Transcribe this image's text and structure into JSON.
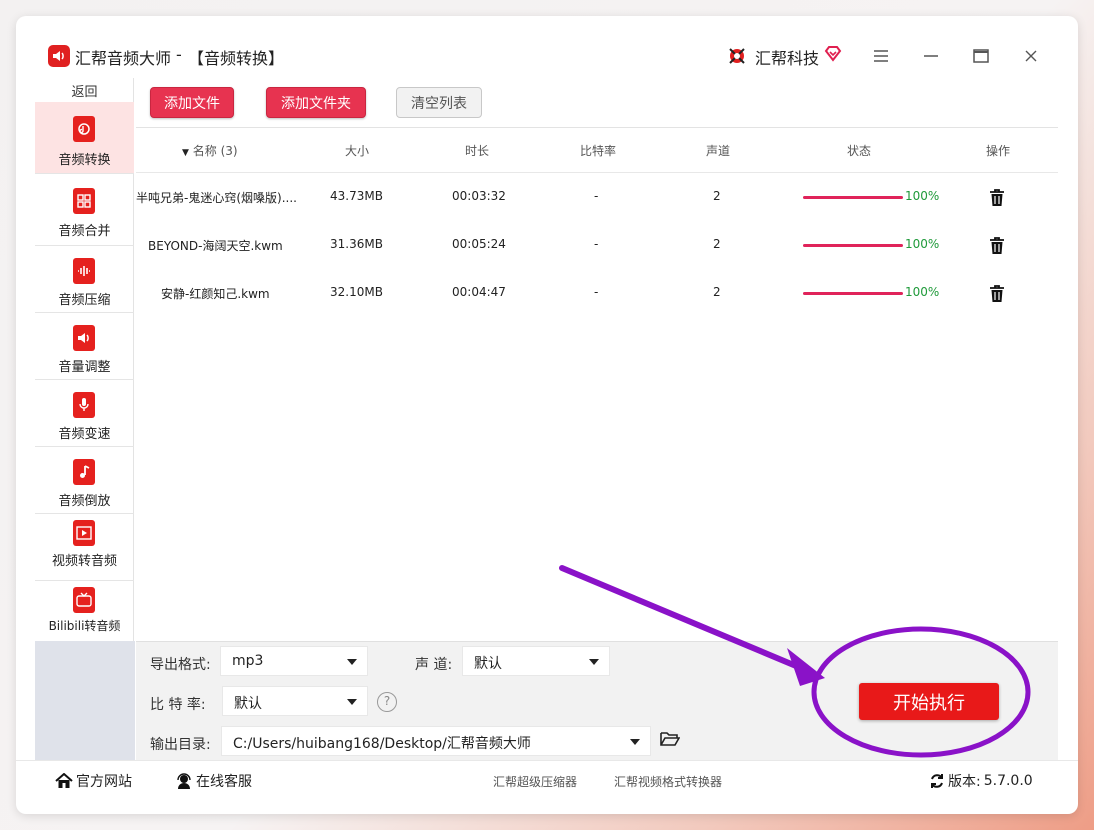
{
  "window": {
    "app_name": "汇帮音频大师",
    "separator": "-",
    "module": "【音频转换】",
    "brand": "汇帮科技"
  },
  "sidebar": {
    "back": "返回",
    "items": [
      {
        "label": "音频转换",
        "icon": "audio-convert-icon",
        "active": true
      },
      {
        "label": "音频合并",
        "icon": "audio-merge-icon",
        "active": false
      },
      {
        "label": "音频压缩",
        "icon": "audio-compress-icon",
        "active": false
      },
      {
        "label": "音量调整",
        "icon": "volume-icon",
        "active": false
      },
      {
        "label": "音频变速",
        "icon": "microphone-icon",
        "active": false
      },
      {
        "label": "音频倒放",
        "icon": "music-note-icon",
        "active": false
      },
      {
        "label": "视频转音频",
        "icon": "video-film-icon",
        "active": false
      },
      {
        "label": "Bilibili转音频",
        "icon": "bilibili-tv-icon",
        "active": false
      }
    ]
  },
  "toolbar": {
    "add_file": "添加文件",
    "add_folder": "添加文件夹",
    "clear_list": "清空列表"
  },
  "table": {
    "headers": {
      "name": "名称 (3)",
      "size": "大小",
      "duration": "时长",
      "bitrate": "比特率",
      "channels": "声道",
      "status": "状态",
      "action": "操作"
    },
    "rows": [
      {
        "name": "半吨兄弟-鬼迷心窍(烟嗓版)....",
        "size": "43.73MB",
        "duration": "00:03:32",
        "bitrate": "-",
        "channels": "2",
        "progress": "100%"
      },
      {
        "name": "BEYOND-海阔天空.kwm",
        "size": "31.36MB",
        "duration": "00:05:24",
        "bitrate": "-",
        "channels": "2",
        "progress": "100%"
      },
      {
        "name": "安静-红颜知己.kwm",
        "size": "32.10MB",
        "duration": "00:04:47",
        "bitrate": "-",
        "channels": "2",
        "progress": "100%"
      }
    ]
  },
  "settings": {
    "format_label": "导出格式:",
    "format_value": "mp3",
    "channel_label": "声 道:",
    "channel_value": "默认",
    "bitrate_label": "比 特 率:",
    "bitrate_value": "默认",
    "help": "?",
    "output_label": "输出目录:",
    "output_value": "C:/Users/huibang168/Desktop/汇帮音频大师",
    "start": "开始执行"
  },
  "statusbar": {
    "website": "官方网站",
    "support": "在线客服",
    "link1": "汇帮超级压缩器",
    "link2": "汇帮视频格式转换器",
    "version_label": "版本:",
    "version": "5.7.0.0"
  },
  "colors": {
    "accent_red": "#e81919",
    "button_pink": "#e73350",
    "progress": "#e0235a",
    "progress_text": "#1f9a3a",
    "annotation_purple": "#8a12c8"
  }
}
